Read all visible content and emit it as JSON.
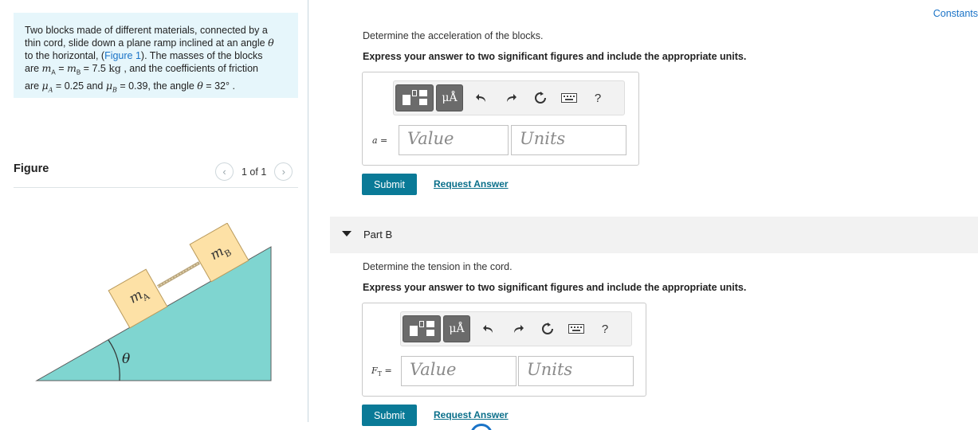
{
  "problem": {
    "line1": "Two blocks made of different materials, connected by a",
    "line2_a": "thin cord, slide down a plane ramp inclined at an angle ",
    "theta": "θ",
    "line3_a": "to the horizontal, (",
    "figure_link": "Figure 1",
    "line3_b": "). The masses of the blocks",
    "line4_a": "are ",
    "mA": "m",
    "mA_sub": "A",
    "eq1": " = ",
    "mB": "m",
    "mB_sub": "B",
    "mass_value": " = 7.5 ",
    "mass_unit": "kg",
    "line4_b": " , and the coefficients of friction",
    "line5_a": "are ",
    "muA": "μ",
    "muA_sub": "A",
    "muA_value": " = 0.25 and ",
    "muB": "μ",
    "muB_sub": "B",
    "muB_value": " = 0.39, the angle ",
    "theta2": "θ",
    "angle_value": " = 32° ."
  },
  "figure": {
    "label": "Figure",
    "pager_text": "1 of 1",
    "block_A_label": "m",
    "block_A_sub": "A",
    "block_B_label": "m",
    "block_B_sub": "B",
    "angle_label": "θ",
    "colors": {
      "ramp": "#7fd5d0",
      "block": "#fde1a6"
    }
  },
  "header": {
    "constants_link": "Constants"
  },
  "part_a": {
    "question": "Determine the acceleration of the blocks.",
    "instruction": "Express your answer to two significant figures and include the appropriate units.",
    "var_label": "a =",
    "value_placeholder": "Value",
    "units_placeholder": "Units",
    "submit_label": "Submit",
    "request_label": "Request Answer"
  },
  "part_b": {
    "title": "Part B",
    "question": "Determine the tension in the cord.",
    "instruction": "Express your answer to two significant figures and include the appropriate units.",
    "var_label": "F",
    "var_sub": "T",
    "var_eq": " =",
    "value_placeholder": "Value",
    "units_placeholder": "Units",
    "submit_label": "Submit",
    "request_label": "Request Answer"
  },
  "toolbar": {
    "mu_label": "μÅ",
    "help_label": "?",
    "icons": [
      "templates-icon",
      "units-icon",
      "undo-icon",
      "redo-icon",
      "reset-icon",
      "keyboard-icon",
      "help-icon"
    ]
  },
  "colors": {
    "accent": "#0a7a97",
    "link": "#1a73c7",
    "problem_bg": "#e6f6fb"
  }
}
